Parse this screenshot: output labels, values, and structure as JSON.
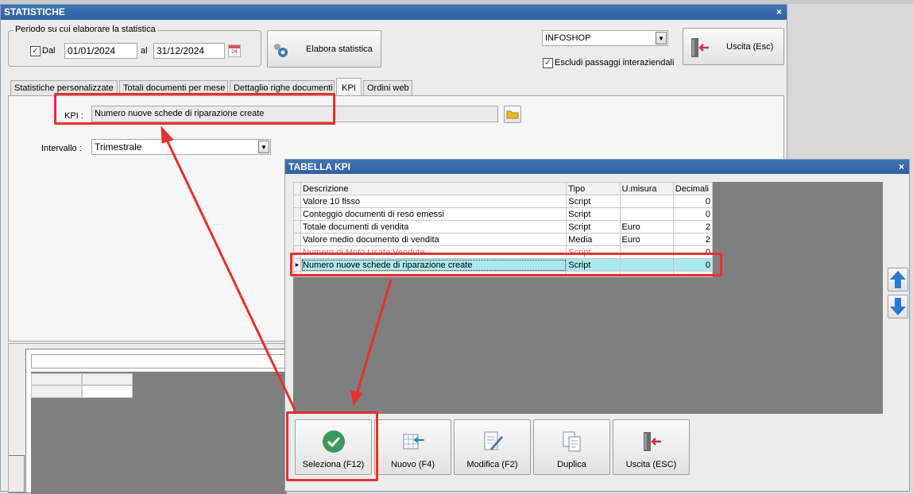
{
  "main_window": {
    "title": "STATISTICHE",
    "close": "×",
    "period_group_label": "Periodo su cui elaborare la statistica",
    "dal_label": "Dal",
    "dal_checked": true,
    "date_from": "01/01/2024",
    "al_label": "al",
    "date_to": "31/12/2024",
    "calendar_day": "24",
    "elabora_label": "Elabora statistica",
    "company_value": "INFOSHOP",
    "escludi_label": "Escludi passaggi interaziendali",
    "escludi_checked": true,
    "uscita_label": "Uscita (Esc)",
    "tabs": [
      "Statistiche personalizzate",
      "Totali documenti per mese",
      "Dettaglio righe documenti",
      "KPI",
      "Ordini web"
    ],
    "active_tab": "KPI",
    "kpi_label": "KPI :",
    "kpi_value": "Numero nuove schede di riparazione create",
    "intervallo_label": "Intervallo :",
    "intervallo_value": "Trimestrale"
  },
  "kpi_dialog": {
    "title": "TABELLA KPI",
    "close": "×",
    "columns": [
      "Descrizione",
      "Tipo",
      "U.misura",
      "Decimali"
    ],
    "rows": [
      {
        "descrizione": "Valore 10 fisso",
        "tipo": "Script",
        "umisura": "",
        "decimali": "0"
      },
      {
        "descrizione": "Conteggio documenti di reso emessi",
        "tipo": "Script",
        "umisura": "",
        "decimali": "0"
      },
      {
        "descrizione": "Totale documenti di vendita",
        "tipo": "Script",
        "umisura": "Euro",
        "decimali": "2"
      },
      {
        "descrizione": "Valore medio documento di vendita",
        "tipo": "Media",
        "umisura": "Euro",
        "decimali": "2"
      },
      {
        "descrizione": "Numero di Moto Usate Vendute",
        "tipo": "Script",
        "umisura": "",
        "decimali": "0"
      },
      {
        "descrizione": "Numero nuove schede di riparazione create",
        "tipo": "Script",
        "umisura": "",
        "decimali": "0"
      }
    ],
    "selected_row_marker": "▸",
    "buttons": {
      "seleziona": "Seleziona (F12)",
      "nuovo": "Nuovo (F4)",
      "modifica": "Modifica (F2)",
      "duplica": "Duplica",
      "uscita": "Uscita (ESC)"
    }
  },
  "colors": {
    "title_bar": "#2f5f9e",
    "highlight": "#e8302a",
    "selected_row": "#a9e9ee",
    "grid_background": "#7f7f7f",
    "arrow_blue": "#2b7bd4"
  }
}
